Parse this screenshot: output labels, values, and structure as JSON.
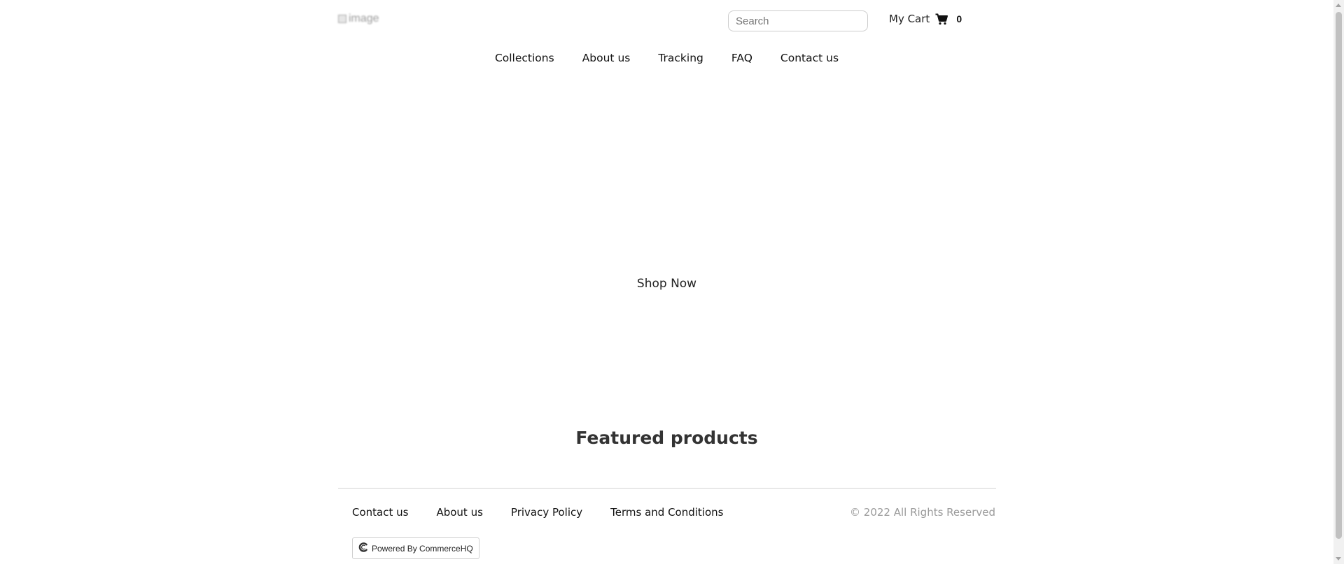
{
  "header": {
    "logo_alt": "image",
    "search_placeholder": "Search",
    "cart_label": "My Cart",
    "cart_count": "0",
    "cart_icon": "shopping-cart-icon"
  },
  "nav": {
    "items": [
      "Collections",
      "About us",
      "Tracking",
      "FAQ",
      "Contact us"
    ]
  },
  "hero": {
    "cta": "Shop Now"
  },
  "featured": {
    "heading": "Featured products"
  },
  "footer": {
    "links": [
      "Contact us",
      "About us",
      "Privacy Policy",
      "Terms and Conditions"
    ],
    "copyright": "© 2022 All Rights Reserved",
    "powered_by": "Powered By CommerceHQ",
    "powered_icon": "commercehq-logo-icon"
  }
}
